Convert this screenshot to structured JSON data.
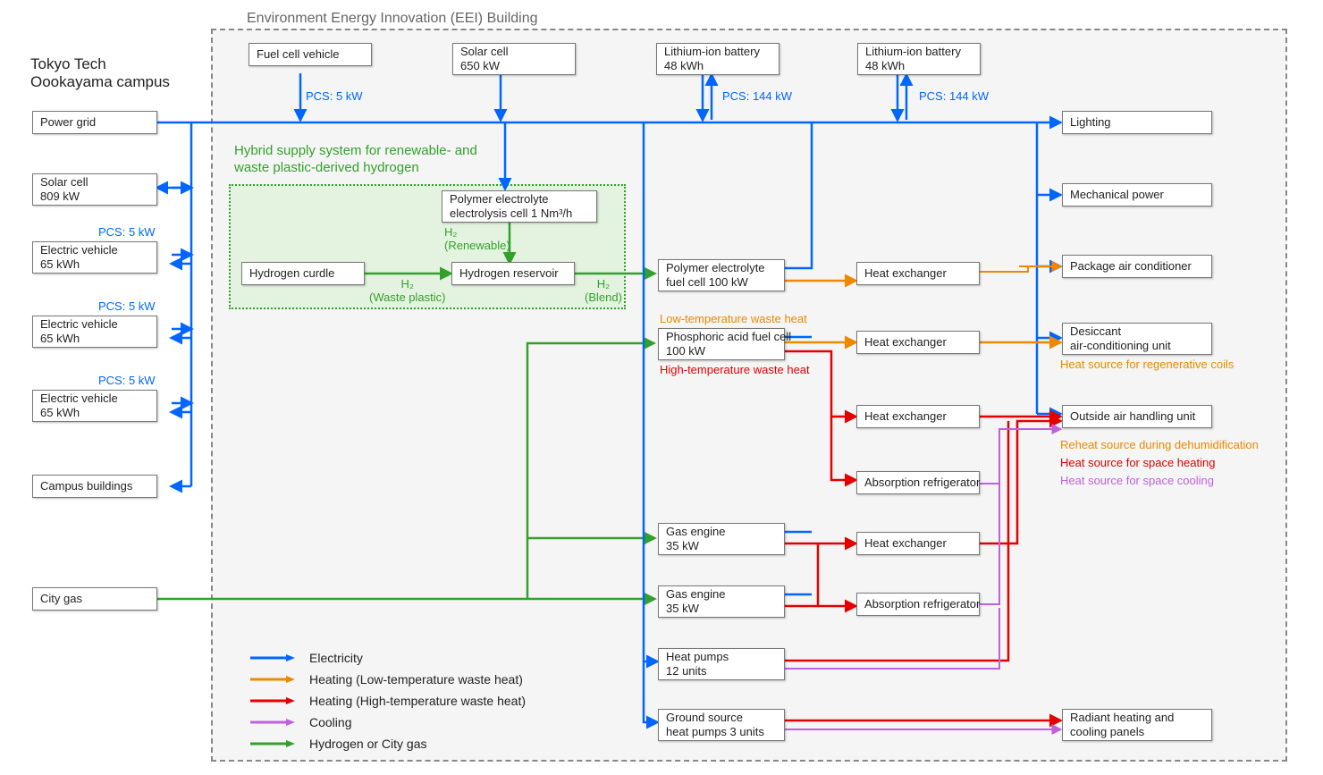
{
  "title_building": "Environment Energy Innovation (EEI) Building",
  "subtitle_campus_l1": "Tokyo Tech",
  "subtitle_campus_l2": "Oookayama campus",
  "h2box_title_l1": "Hybrid supply system for renewable- and",
  "h2box_title_l2": "waste plastic-derived hydrogen",
  "nodes": {
    "pg": {
      "l1": "Power grid"
    },
    "sc809": {
      "l1": "Solar cell",
      "l2": "809 kW"
    },
    "ev1": {
      "l1": "Electric vehicle",
      "l2": "65 kWh"
    },
    "ev2": {
      "l1": "Electric vehicle",
      "l2": "65 kWh"
    },
    "ev3": {
      "l1": "Electric vehicle",
      "l2": "65 kWh"
    },
    "cb": {
      "l1": "Campus buildings"
    },
    "cg": {
      "l1": "City gas"
    },
    "fcv": {
      "l1": "Fuel cell vehicle"
    },
    "sc650": {
      "l1": "Solar cell",
      "l2": "650 kW"
    },
    "li1": {
      "l1": "Lithium-ion battery",
      "l2": "48 kWh"
    },
    "li2": {
      "l1": "Lithium-ion battery",
      "l2": "48 kWh"
    },
    "pee": {
      "l1": "Polymer electrolyte",
      "l2": "electrolysis cell 1 Nm³/h"
    },
    "hcur": {
      "l1": "Hydrogen curdle"
    },
    "hres": {
      "l1": "Hydrogen reservoir"
    },
    "pefc": {
      "l1": "Polymer electrolyte",
      "l2": "fuel cell 100 kW"
    },
    "pafc": {
      "l1": "Phosphoric acid fuel cell",
      "l2": "100 kW"
    },
    "ge1": {
      "l1": "Gas engine",
      "l2": "35 kW"
    },
    "ge2": {
      "l1": "Gas engine",
      "l2": "35 kW"
    },
    "hpu": {
      "l1": "Heat pumps",
      "l2": "12 units"
    },
    "gshp": {
      "l1": "Ground source",
      "l2": "heat pumps 3 units"
    },
    "hx1": {
      "l1": "Heat exchanger"
    },
    "hx2": {
      "l1": "Heat exchanger"
    },
    "hx3": {
      "l1": "Heat exchanger"
    },
    "hx4": {
      "l1": "Heat exchanger"
    },
    "ar1": {
      "l1": "Absorption refrigerator"
    },
    "ar2": {
      "l1": "Absorption refrigerator"
    },
    "light": {
      "l1": "Lighting"
    },
    "mech": {
      "l1": "Mechanical power"
    },
    "pac": {
      "l1": "Package air conditioner"
    },
    "dac": {
      "l1": "Desiccant",
      "l2": "air-conditioning unit"
    },
    "oahu": {
      "l1": "Outside air handling unit"
    },
    "rhc": {
      "l1": "Radiant heating and",
      "l2": "cooling panels"
    }
  },
  "wirelabels": {
    "pcs5_fcv": "PCS: 5 kW",
    "pcs144_a": "PCS: 144 kW",
    "pcs144_b": "PCS: 144 kW",
    "pcs5_ev1": "PCS: 5 kW",
    "pcs5_ev2": "PCS: 5 kW",
    "pcs5_ev3": "PCS: 5 kW",
    "h2_renewable": "H₂\n(Renewable)",
    "h2_wasteplastic": "H₂\n(Waste plastic)",
    "h2_blend": "H₂\n(Blend)",
    "ltwh": "Low-temperature waste heat",
    "htwh": "High-temperature waste heat",
    "hs_regen": "Heat source for regenerative coils",
    "reheat": "Reheat source during dehumidification",
    "hs_heat": "Heat source for space heating",
    "hs_cool": "Heat source for space cooling"
  },
  "legend": {
    "electricity": "Electricity",
    "heating_low": "Heating (Low-temperature waste heat)",
    "heating_high": "Heating (High-temperature waste heat)",
    "cooling": "Cooling",
    "h2gas": "Hydrogen or City gas"
  },
  "colors": {
    "blue": "#0066ff",
    "green": "#33a02c",
    "orange": "#ee8800",
    "red": "#e40000",
    "purple": "#c060e0"
  }
}
